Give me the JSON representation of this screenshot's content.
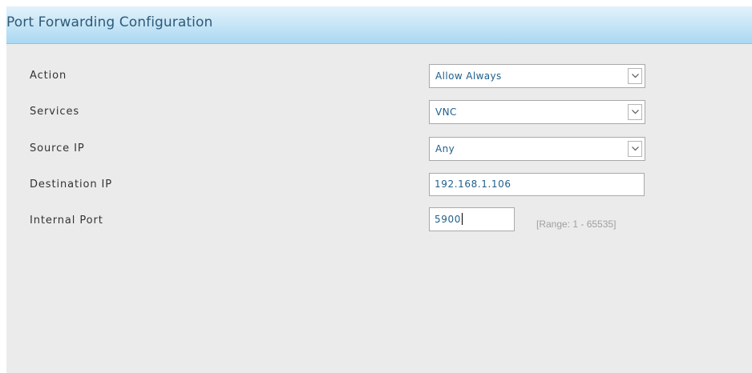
{
  "panel": {
    "title": "Port Forwarding Configuration"
  },
  "form": {
    "action": {
      "label": "Action",
      "selected": "Allow Always",
      "icon": "chevron-down-icon"
    },
    "services": {
      "label": "Services",
      "selected": "VNC",
      "icon": "chevron-down-icon"
    },
    "source_ip": {
      "label": "Source IP",
      "selected": "Any",
      "icon": "chevron-down-icon"
    },
    "destination_ip": {
      "label": "Destination IP",
      "value": "192.168.1.106"
    },
    "internal_port": {
      "label": "Internal Port",
      "value": "5900",
      "hint": "[Range: 1 - 65535]"
    }
  },
  "colors": {
    "header_gradient_top": "#e3f2fb",
    "header_gradient_bottom": "#aad8f2",
    "title_text": "#2e5a78",
    "field_value_text": "#1f5f8b",
    "panel_background": "#ebebeb",
    "hint_text": "#a0a0a0"
  }
}
